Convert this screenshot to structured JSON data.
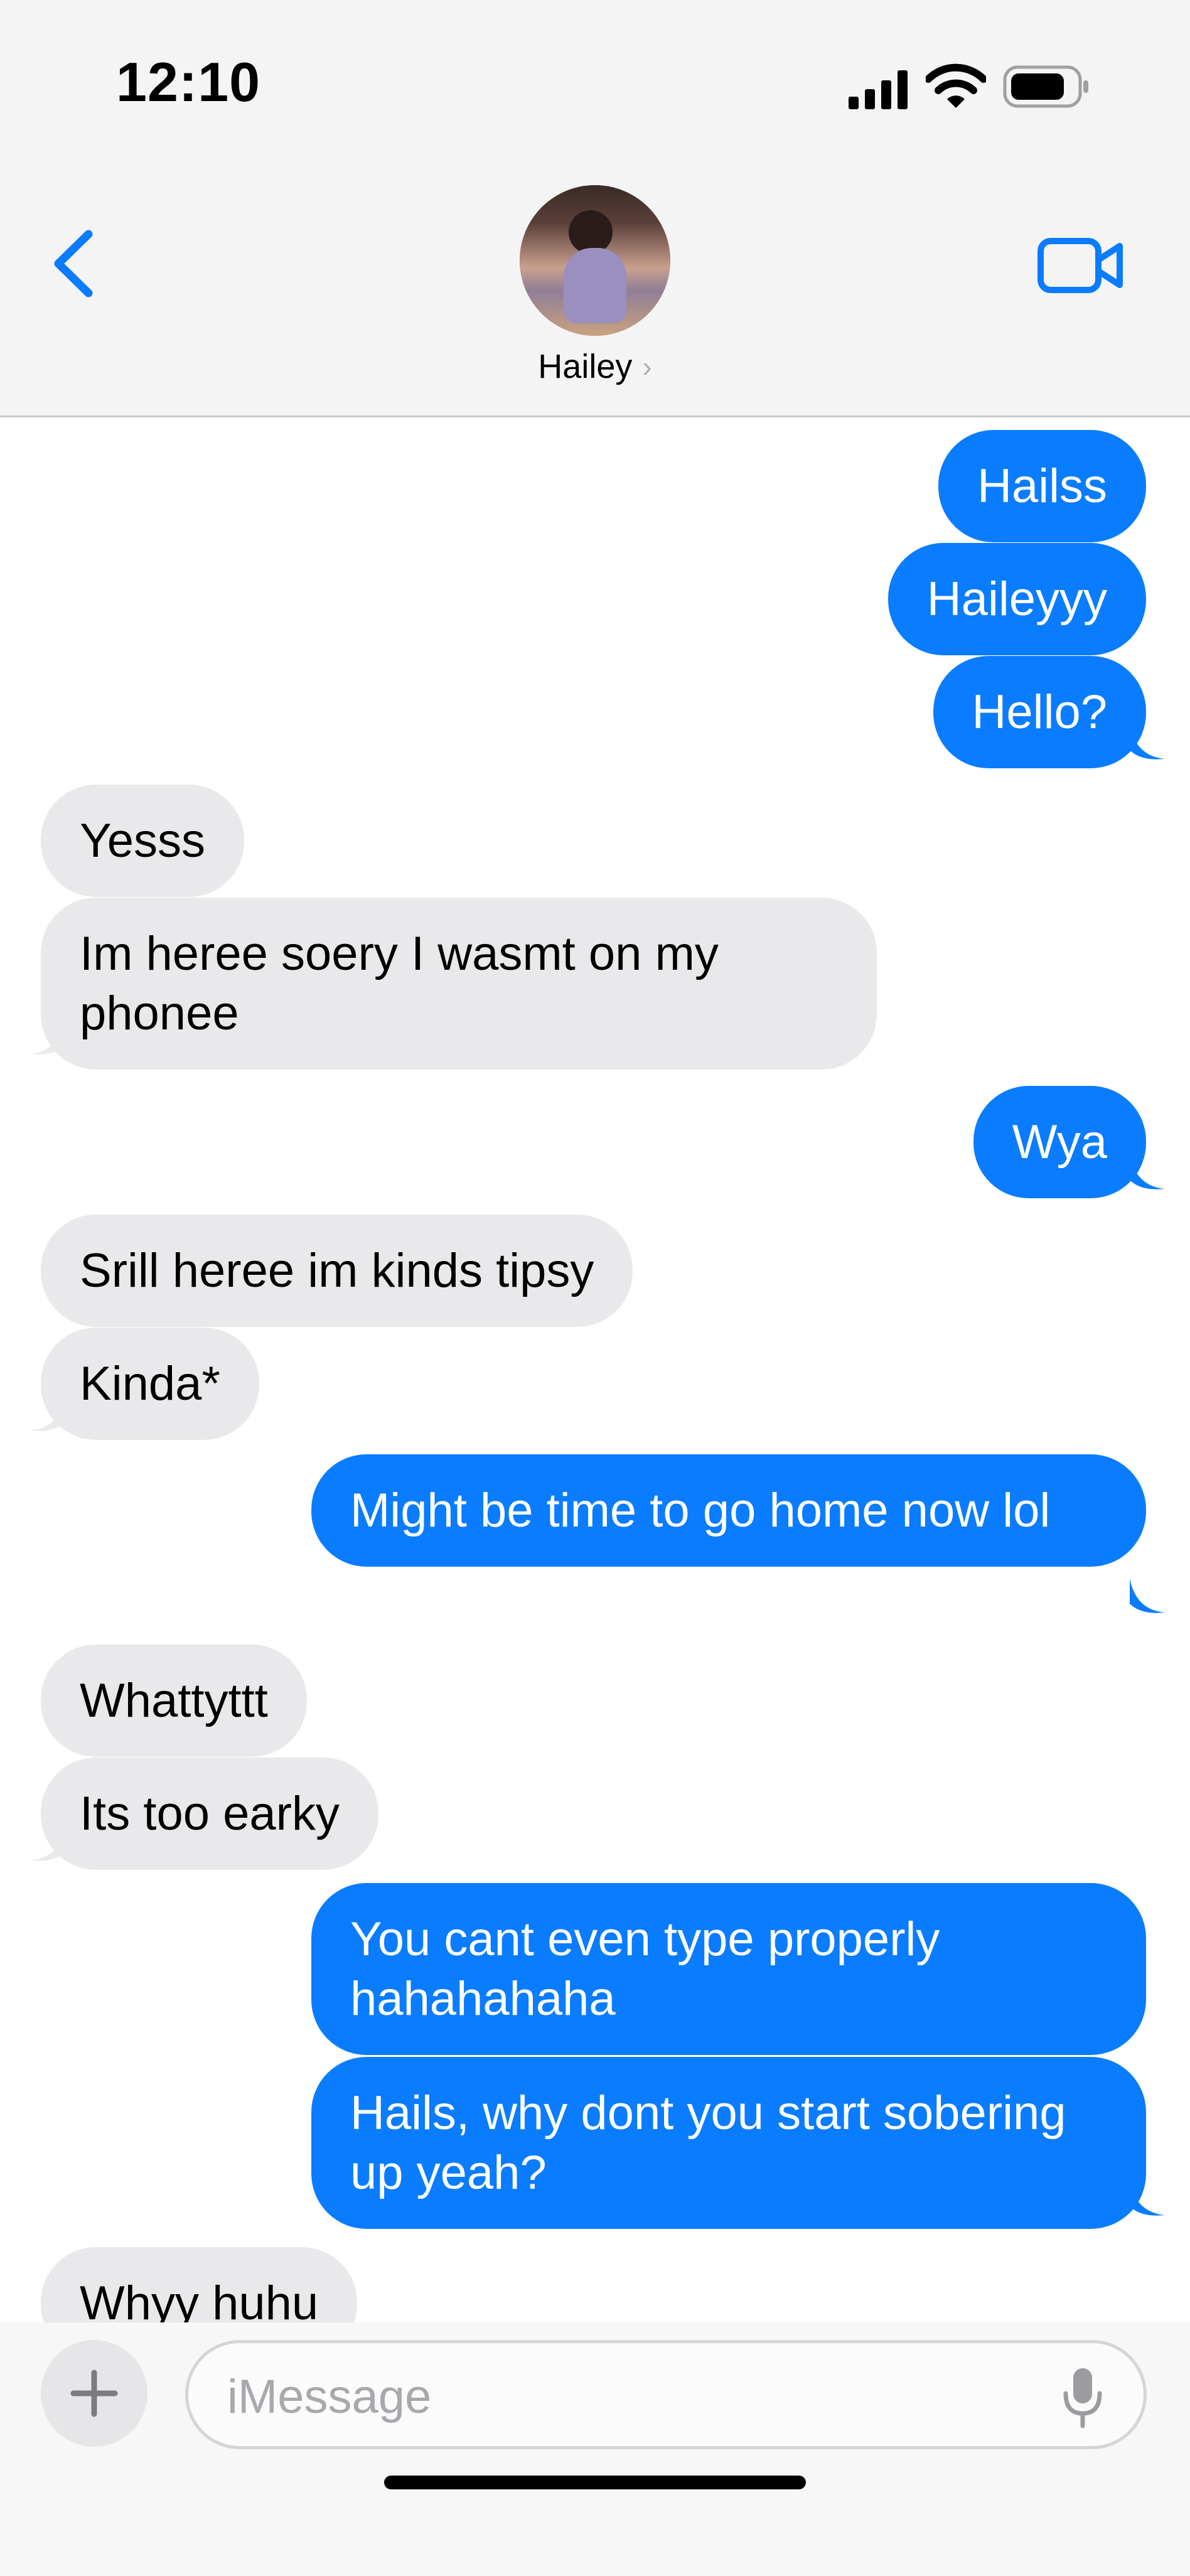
{
  "status_bar": {
    "time": "12:10"
  },
  "header": {
    "contact_name": "Hailey",
    "chevron": "›",
    "back_icon": "chevron-left-icon",
    "video_icon": "video-camera-icon"
  },
  "messages": [
    {
      "from": "me",
      "text": "Hailss"
    },
    {
      "from": "me",
      "text": "Haileyyy"
    },
    {
      "from": "me",
      "text": "Hello?"
    },
    {
      "from": "them",
      "text": "Yesss"
    },
    {
      "from": "them",
      "text": "Im heree soery I wasmt on my phonee"
    },
    {
      "from": "me",
      "text": "Wya"
    },
    {
      "from": "them",
      "text": "Srill heree im kinds tipsy"
    },
    {
      "from": "them",
      "text": "Kinda*"
    },
    {
      "from": "me",
      "text": "Might be time to go home now lol"
    },
    {
      "from": "them",
      "text": "Whattyttt"
    },
    {
      "from": "them",
      "text": "Its too earky"
    },
    {
      "from": "me",
      "text": "You cant even type properly hahahahaha"
    },
    {
      "from": "me",
      "text": "Hails, why dont you start sobering up yeah?"
    },
    {
      "from": "them",
      "text": "Whyy huhu"
    }
  ],
  "composer": {
    "placeholder": "iMessage",
    "plus": "+"
  },
  "colors": {
    "sent": "#0a7cff",
    "received": "#e9e9eb",
    "accent": "#0a7cff"
  }
}
